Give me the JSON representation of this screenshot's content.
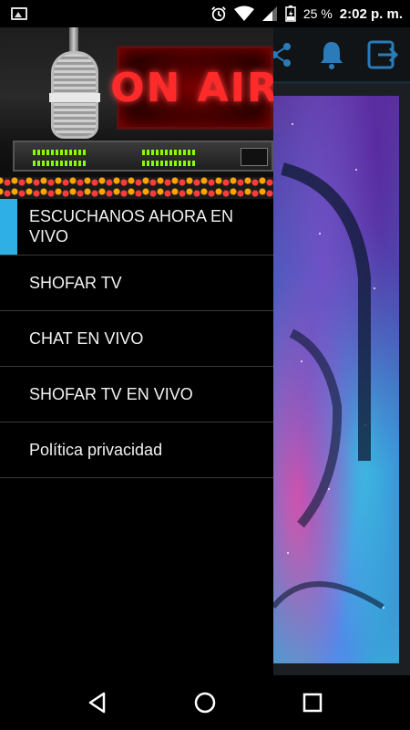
{
  "status_bar": {
    "battery_percent": "25 %",
    "time": "2:02 p. m.",
    "icons": [
      "image-notification-icon",
      "alarm-icon",
      "wifi-icon",
      "signal-icon",
      "battery-icon"
    ]
  },
  "drawer": {
    "header_sign": "ON AIR",
    "menu": [
      {
        "label": "ESCUCHANOS AHORA EN VIVO",
        "active": true
      },
      {
        "label": "SHOFAR TV",
        "active": false
      },
      {
        "label": "CHAT EN VIVO",
        "active": false
      },
      {
        "label": "SHOFAR TV EN VIVO",
        "active": false
      },
      {
        "label": "Política privacidad",
        "active": false
      }
    ]
  },
  "toolbar": {
    "icons": [
      "share-icon",
      "bell-icon",
      "exit-icon"
    ]
  },
  "navigation": {
    "buttons": [
      "back-icon",
      "home-icon",
      "recents-icon"
    ]
  },
  "colors": {
    "active_indicator": "#2eb0e6",
    "toolbar_icon": "#2b7bb8",
    "drawer_bg": "#000000"
  }
}
